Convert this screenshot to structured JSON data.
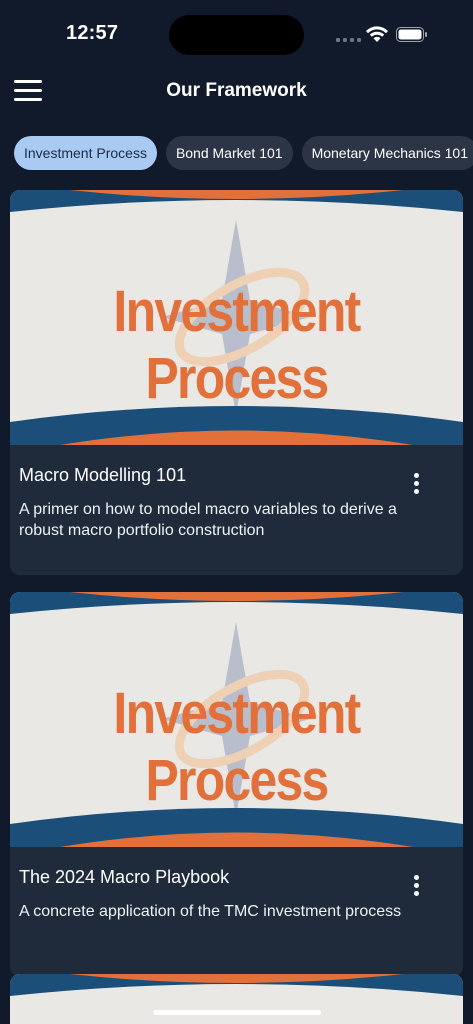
{
  "status_bar": {
    "time": "12:57"
  },
  "header": {
    "title": "Our Framework",
    "menu_icon": "hamburger-menu-icon"
  },
  "tabs": [
    {
      "label": "Investment Process",
      "selected": true
    },
    {
      "label": "Bond Market 101",
      "selected": false
    },
    {
      "label": "Monetary Mechanics 101",
      "selected": false
    }
  ],
  "cards": [
    {
      "image_text": "Investment Process",
      "title": "Macro Modelling 101",
      "description": "A primer on how to model macro variables to derive a robust macro portfolio construction"
    },
    {
      "image_text": "Investment Process",
      "title": "The 2024 Macro Playbook",
      "description": "A concrete application of the TMC investment process"
    }
  ],
  "colors": {
    "background": "#111a2b",
    "card": "#1f2a3b",
    "accent_orange": "#e2703a",
    "accent_navy": "#1b4e78",
    "chip_active": "#a9cbf3",
    "chip_inactive": "#2b3546"
  }
}
